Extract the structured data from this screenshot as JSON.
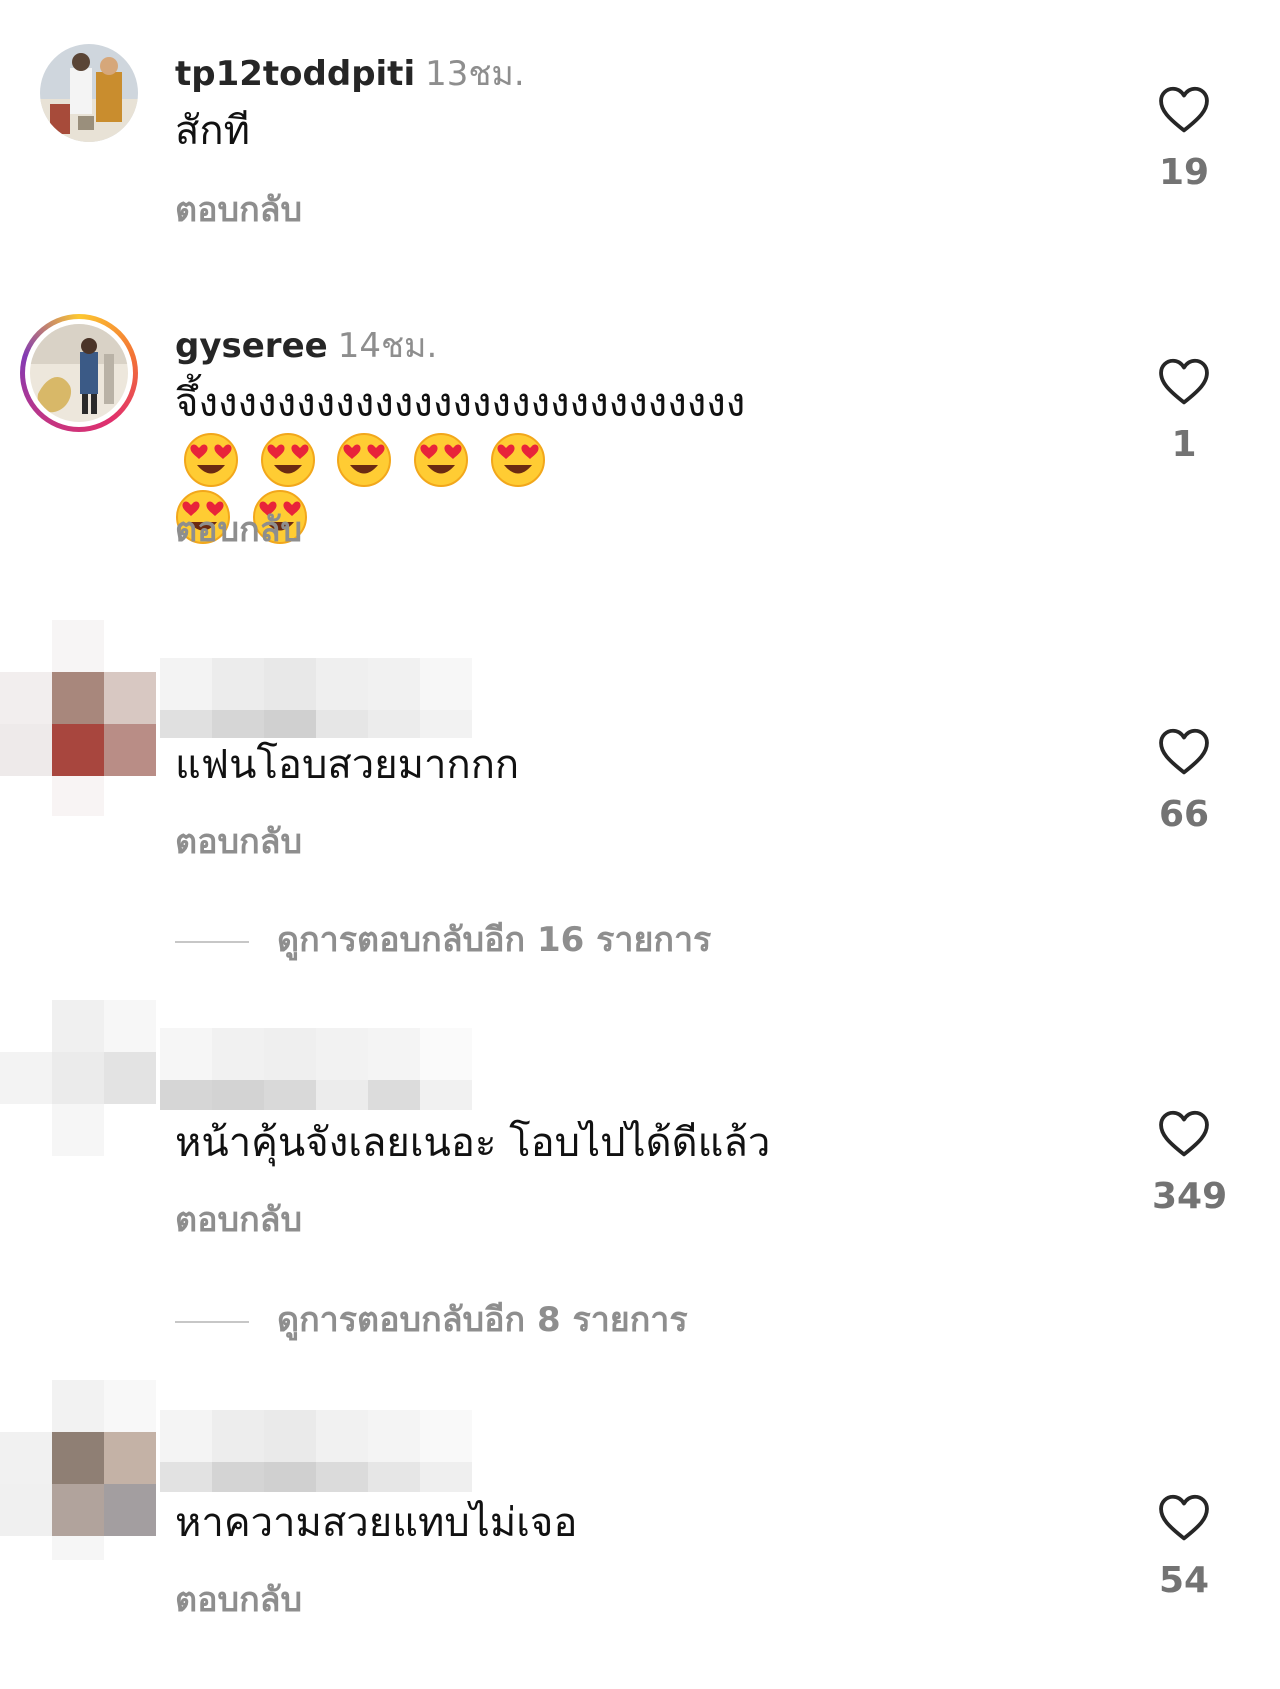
{
  "comments": [
    {
      "username": "tp12toddpiti",
      "time": "13ชม.",
      "text": "สักที",
      "reply_label": "ตอบกลับ",
      "likes": "19"
    },
    {
      "username": "gyseree",
      "time": "14ชม.",
      "text": "จึ้งงงงงงงงงงงงงงงงงงงงงงงงงงงง",
      "reply_label": "ตอบกลับ",
      "likes": "1",
      "emoji": "heart-eyes-emoji",
      "emoji_count": 7
    },
    {
      "username": "",
      "time": "",
      "text": "แฟนโอบสวยมากกก",
      "reply_label": "ตอบกลับ",
      "likes": "66",
      "view_replies": "ดูการตอบกลับอีก 16 รายการ"
    },
    {
      "username": "",
      "time": "",
      "text": "หน้าคุ้นจังเลยเนอะ โอบไปได้ดีแล้ว",
      "reply_label": "ตอบกลับ",
      "likes": "349",
      "view_replies": "ดูการตอบกลับอีก 8 รายการ"
    },
    {
      "username": "",
      "time": "",
      "text": "หาความสวยแทบไม่เจอ",
      "reply_label": "ตอบกลับ",
      "likes": "54"
    }
  ],
  "colors": {
    "username": "#262626",
    "secondary": "#8e8e8e",
    "story_ring": "#e1306c"
  }
}
